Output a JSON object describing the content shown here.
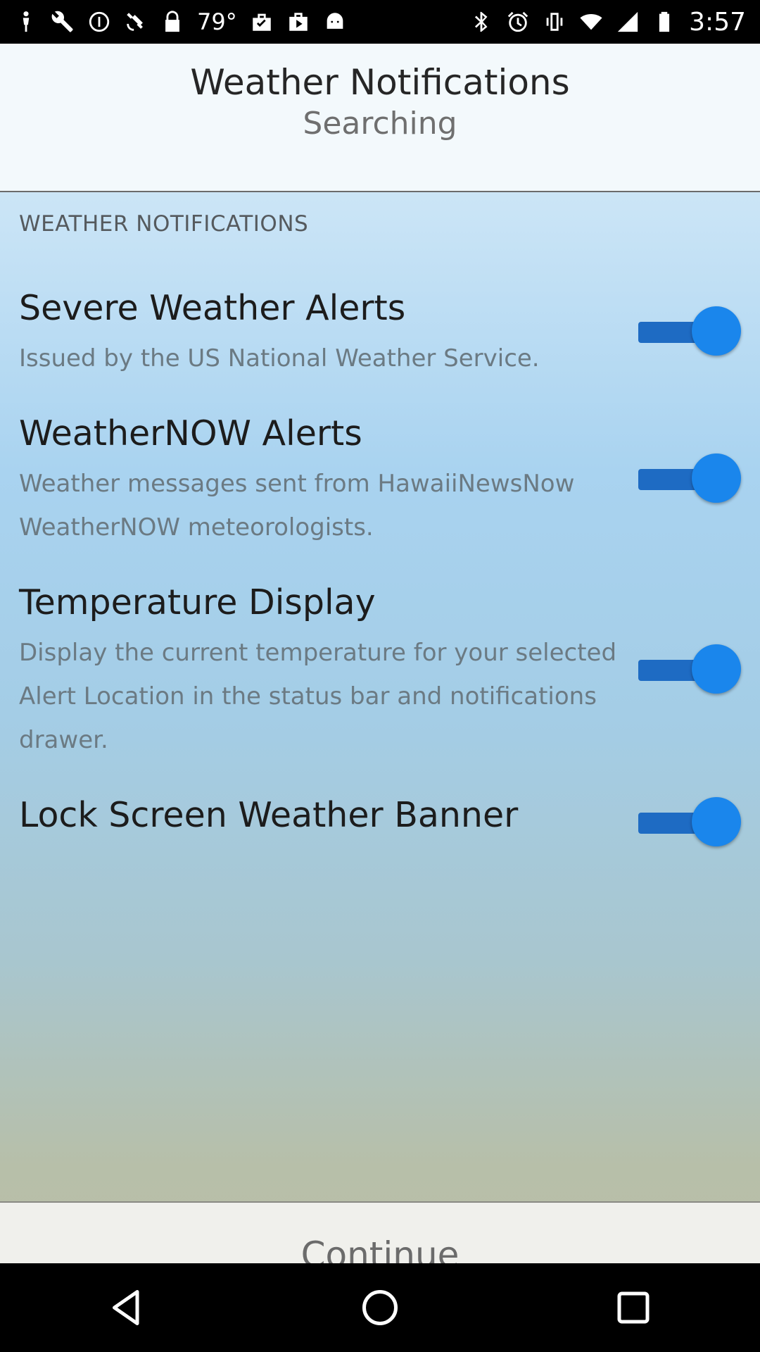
{
  "status_bar": {
    "temperature": "79°",
    "time": "3:57",
    "left_icons": [
      "person-icon",
      "wrench-icon",
      "minus-circle-icon",
      "satellite-icon",
      "lock-icon",
      "temperature-text",
      "checked-bag-icon",
      "play-store-icon",
      "android-icon"
    ],
    "right_icons": [
      "bluetooth-icon",
      "alarm-icon",
      "vibrate-icon",
      "wifi-icon",
      "signal-icon",
      "battery-icon"
    ]
  },
  "header": {
    "title": "Weather Notifications",
    "subtitle": "Searching"
  },
  "section": {
    "header": "WEATHER NOTIFICATIONS"
  },
  "settings": [
    {
      "title": "Severe Weather Alerts",
      "description": "Issued by the US National Weather Service.",
      "enabled": true
    },
    {
      "title": "WeatherNOW Alerts",
      "description": "Weather messages sent from HawaiiNewsNow WeatherNOW meteorologists.",
      "enabled": true
    },
    {
      "title": "Temperature Display",
      "description": "Display the current temperature for your selected Alert Location in the status bar and notifications drawer.",
      "enabled": true
    },
    {
      "title": "Lock Screen Weather Banner",
      "enabled": true
    }
  ],
  "continue_label": "Continue",
  "colors": {
    "toggle_track": "#1e6bc3",
    "toggle_thumb": "#1a86ec"
  },
  "nav_bar": {
    "icons": [
      "back-icon",
      "home-icon",
      "recents-icon"
    ]
  }
}
